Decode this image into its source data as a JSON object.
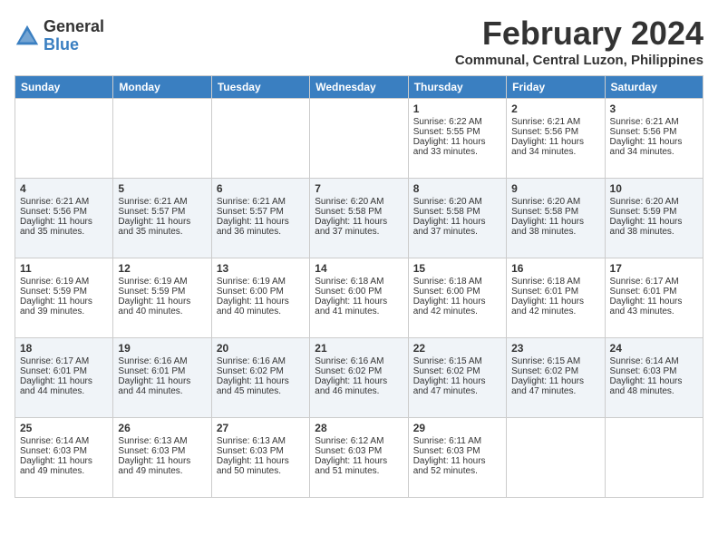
{
  "logo": {
    "general": "General",
    "blue": "Blue"
  },
  "title": "February 2024",
  "location": "Communal, Central Luzon, Philippines",
  "headers": [
    "Sunday",
    "Monday",
    "Tuesday",
    "Wednesday",
    "Thursday",
    "Friday",
    "Saturday"
  ],
  "weeks": [
    [
      {
        "day": "",
        "sunrise": "",
        "sunset": "",
        "daylight": ""
      },
      {
        "day": "",
        "sunrise": "",
        "sunset": "",
        "daylight": ""
      },
      {
        "day": "",
        "sunrise": "",
        "sunset": "",
        "daylight": ""
      },
      {
        "day": "",
        "sunrise": "",
        "sunset": "",
        "daylight": ""
      },
      {
        "day": "1",
        "sunrise": "Sunrise: 6:22 AM",
        "sunset": "Sunset: 5:55 PM",
        "daylight": "Daylight: 11 hours and 33 minutes."
      },
      {
        "day": "2",
        "sunrise": "Sunrise: 6:21 AM",
        "sunset": "Sunset: 5:56 PM",
        "daylight": "Daylight: 11 hours and 34 minutes."
      },
      {
        "day": "3",
        "sunrise": "Sunrise: 6:21 AM",
        "sunset": "Sunset: 5:56 PM",
        "daylight": "Daylight: 11 hours and 34 minutes."
      }
    ],
    [
      {
        "day": "4",
        "sunrise": "Sunrise: 6:21 AM",
        "sunset": "Sunset: 5:56 PM",
        "daylight": "Daylight: 11 hours and 35 minutes."
      },
      {
        "day": "5",
        "sunrise": "Sunrise: 6:21 AM",
        "sunset": "Sunset: 5:57 PM",
        "daylight": "Daylight: 11 hours and 35 minutes."
      },
      {
        "day": "6",
        "sunrise": "Sunrise: 6:21 AM",
        "sunset": "Sunset: 5:57 PM",
        "daylight": "Daylight: 11 hours and 36 minutes."
      },
      {
        "day": "7",
        "sunrise": "Sunrise: 6:20 AM",
        "sunset": "Sunset: 5:58 PM",
        "daylight": "Daylight: 11 hours and 37 minutes."
      },
      {
        "day": "8",
        "sunrise": "Sunrise: 6:20 AM",
        "sunset": "Sunset: 5:58 PM",
        "daylight": "Daylight: 11 hours and 37 minutes."
      },
      {
        "day": "9",
        "sunrise": "Sunrise: 6:20 AM",
        "sunset": "Sunset: 5:58 PM",
        "daylight": "Daylight: 11 hours and 38 minutes."
      },
      {
        "day": "10",
        "sunrise": "Sunrise: 6:20 AM",
        "sunset": "Sunset: 5:59 PM",
        "daylight": "Daylight: 11 hours and 38 minutes."
      }
    ],
    [
      {
        "day": "11",
        "sunrise": "Sunrise: 6:19 AM",
        "sunset": "Sunset: 5:59 PM",
        "daylight": "Daylight: 11 hours and 39 minutes."
      },
      {
        "day": "12",
        "sunrise": "Sunrise: 6:19 AM",
        "sunset": "Sunset: 5:59 PM",
        "daylight": "Daylight: 11 hours and 40 minutes."
      },
      {
        "day": "13",
        "sunrise": "Sunrise: 6:19 AM",
        "sunset": "Sunset: 6:00 PM",
        "daylight": "Daylight: 11 hours and 40 minutes."
      },
      {
        "day": "14",
        "sunrise": "Sunrise: 6:18 AM",
        "sunset": "Sunset: 6:00 PM",
        "daylight": "Daylight: 11 hours and 41 minutes."
      },
      {
        "day": "15",
        "sunrise": "Sunrise: 6:18 AM",
        "sunset": "Sunset: 6:00 PM",
        "daylight": "Daylight: 11 hours and 42 minutes."
      },
      {
        "day": "16",
        "sunrise": "Sunrise: 6:18 AM",
        "sunset": "Sunset: 6:01 PM",
        "daylight": "Daylight: 11 hours and 42 minutes."
      },
      {
        "day": "17",
        "sunrise": "Sunrise: 6:17 AM",
        "sunset": "Sunset: 6:01 PM",
        "daylight": "Daylight: 11 hours and 43 minutes."
      }
    ],
    [
      {
        "day": "18",
        "sunrise": "Sunrise: 6:17 AM",
        "sunset": "Sunset: 6:01 PM",
        "daylight": "Daylight: 11 hours and 44 minutes."
      },
      {
        "day": "19",
        "sunrise": "Sunrise: 6:16 AM",
        "sunset": "Sunset: 6:01 PM",
        "daylight": "Daylight: 11 hours and 44 minutes."
      },
      {
        "day": "20",
        "sunrise": "Sunrise: 6:16 AM",
        "sunset": "Sunset: 6:02 PM",
        "daylight": "Daylight: 11 hours and 45 minutes."
      },
      {
        "day": "21",
        "sunrise": "Sunrise: 6:16 AM",
        "sunset": "Sunset: 6:02 PM",
        "daylight": "Daylight: 11 hours and 46 minutes."
      },
      {
        "day": "22",
        "sunrise": "Sunrise: 6:15 AM",
        "sunset": "Sunset: 6:02 PM",
        "daylight": "Daylight: 11 hours and 47 minutes."
      },
      {
        "day": "23",
        "sunrise": "Sunrise: 6:15 AM",
        "sunset": "Sunset: 6:02 PM",
        "daylight": "Daylight: 11 hours and 47 minutes."
      },
      {
        "day": "24",
        "sunrise": "Sunrise: 6:14 AM",
        "sunset": "Sunset: 6:03 PM",
        "daylight": "Daylight: 11 hours and 48 minutes."
      }
    ],
    [
      {
        "day": "25",
        "sunrise": "Sunrise: 6:14 AM",
        "sunset": "Sunset: 6:03 PM",
        "daylight": "Daylight: 11 hours and 49 minutes."
      },
      {
        "day": "26",
        "sunrise": "Sunrise: 6:13 AM",
        "sunset": "Sunset: 6:03 PM",
        "daylight": "Daylight: 11 hours and 49 minutes."
      },
      {
        "day": "27",
        "sunrise": "Sunrise: 6:13 AM",
        "sunset": "Sunset: 6:03 PM",
        "daylight": "Daylight: 11 hours and 50 minutes."
      },
      {
        "day": "28",
        "sunrise": "Sunrise: 6:12 AM",
        "sunset": "Sunset: 6:03 PM",
        "daylight": "Daylight: 11 hours and 51 minutes."
      },
      {
        "day": "29",
        "sunrise": "Sunrise: 6:11 AM",
        "sunset": "Sunset: 6:03 PM",
        "daylight": "Daylight: 11 hours and 52 minutes."
      },
      {
        "day": "",
        "sunrise": "",
        "sunset": "",
        "daylight": ""
      },
      {
        "day": "",
        "sunrise": "",
        "sunset": "",
        "daylight": ""
      }
    ]
  ]
}
